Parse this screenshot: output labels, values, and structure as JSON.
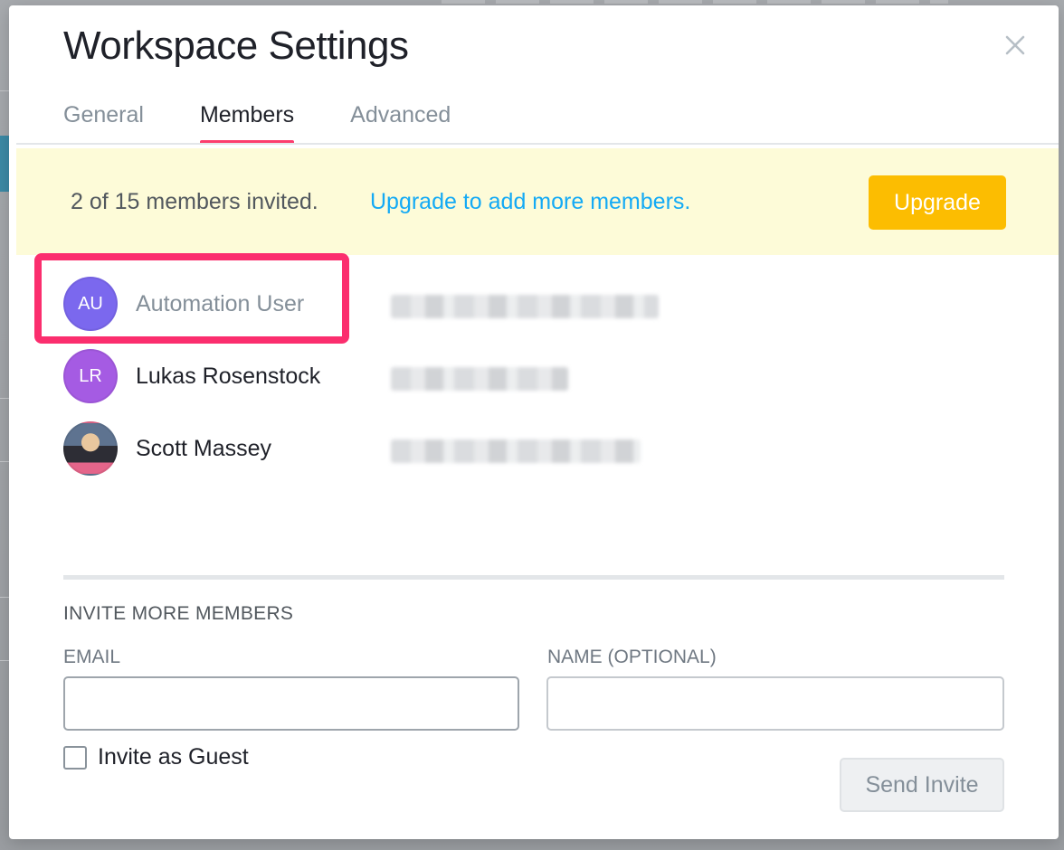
{
  "modal": {
    "title": "Workspace Settings",
    "tabs": [
      {
        "label": "General",
        "active": false
      },
      {
        "label": "Members",
        "active": true
      },
      {
        "label": "Advanced",
        "active": false
      }
    ],
    "close_icon": "close-icon"
  },
  "banner": {
    "status_text": "2 of 15 members invited.",
    "link_text": "Upgrade to add more members.",
    "upgrade_label": "Upgrade"
  },
  "members": [
    {
      "initials": "AU",
      "name": "Automation User",
      "avatar_color": "#7b68ee",
      "highlighted": true
    },
    {
      "initials": "LR",
      "name": "Lukas Rosenstock",
      "avatar_color": "#a55be3",
      "highlighted": false
    },
    {
      "initials": "",
      "name": "Scott Massey",
      "avatar_color": "photo",
      "highlighted": false
    }
  ],
  "invite": {
    "heading": "INVITE MORE MEMBERS",
    "email_label": "EMAIL",
    "email_value": "",
    "name_label": "NAME (OPTIONAL)",
    "name_value": "",
    "guest_label": "Invite as Guest",
    "guest_checked": false,
    "send_label": "Send Invite"
  },
  "colors": {
    "accent_tab": "#fc3d6d",
    "link": "#14aaf5",
    "upgrade": "#fcbd01",
    "highlight": "#fb2e6e",
    "banner_bg": "#fdfbd8"
  }
}
